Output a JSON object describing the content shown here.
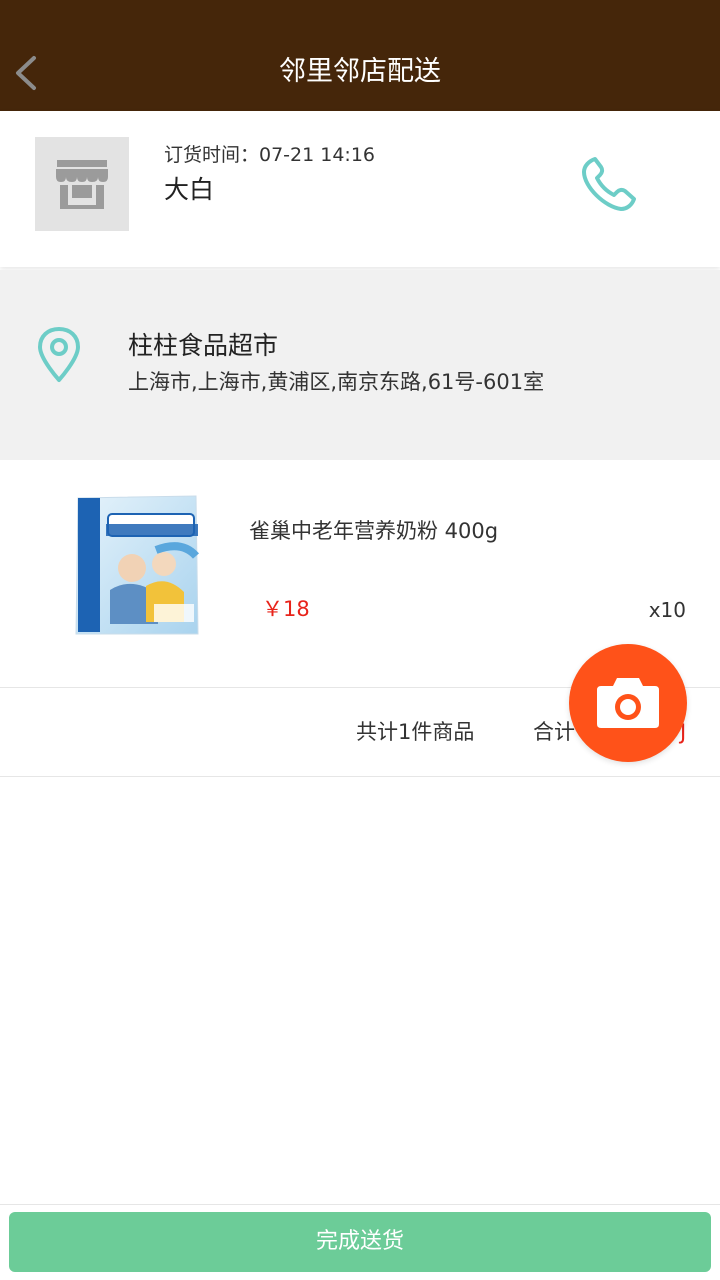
{
  "header": {
    "title": "邻里邻店配送",
    "back_icon": "chevron-left-icon"
  },
  "customer": {
    "order_time": "订货时间：07-21 14:16",
    "name": "大白",
    "avatar_icon": "store-icon",
    "phone_icon": "phone-icon"
  },
  "address": {
    "icon": "location-pin-icon",
    "store_name": "柱柱食品超市",
    "full_address": "上海市,上海市,黄浦区,南京东路,61号-601室"
  },
  "products": [
    {
      "name": "雀巢中老年营养奶粉 400g",
      "price": "￥18",
      "quantity": "x10"
    }
  ],
  "summary": {
    "count_text": "共计1件商品",
    "total_label": "合计",
    "total_amount_visible": "J"
  },
  "camera_fab": {
    "icon": "camera-icon"
  },
  "footer": {
    "complete_label": "完成送货"
  },
  "colors": {
    "header_bg": "#45260a",
    "accent_teal": "#6dcdc7",
    "price_red": "#e8231a",
    "fab_orange": "#ff5219",
    "button_green": "#6ccc98",
    "section_gray": "#f1f1f1"
  }
}
